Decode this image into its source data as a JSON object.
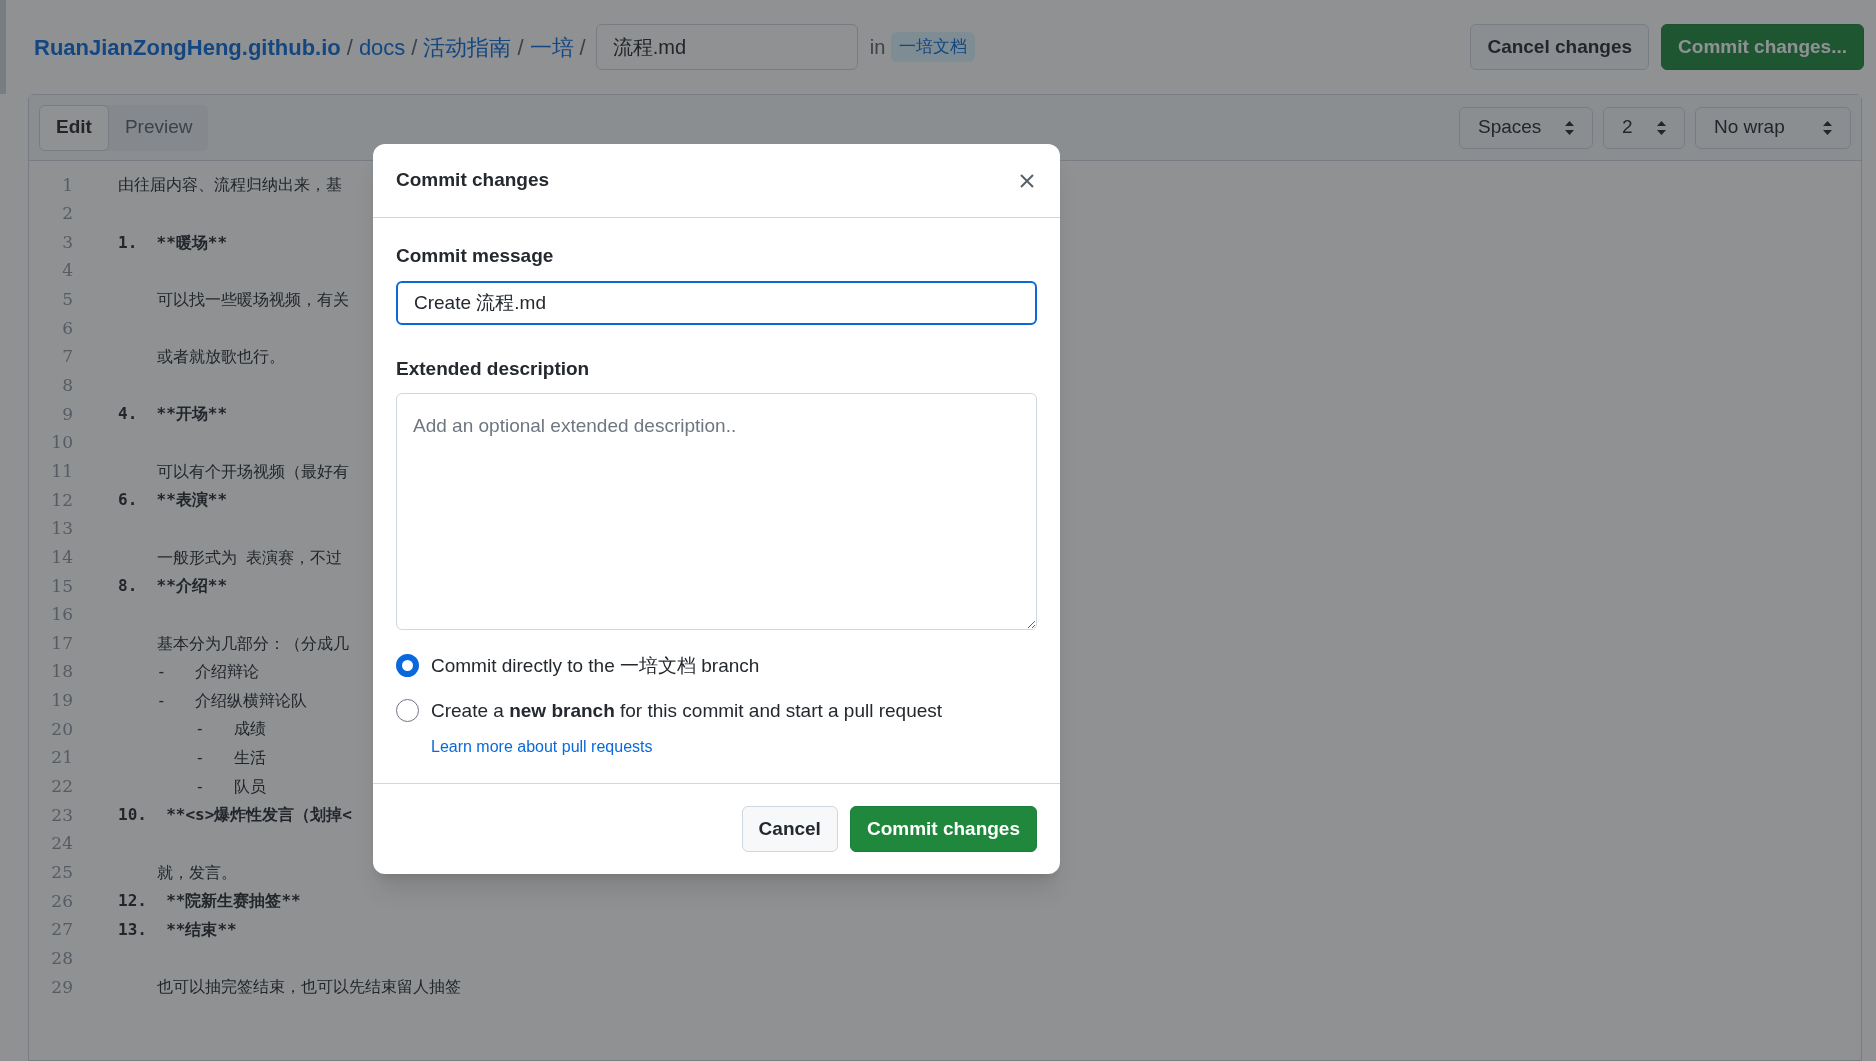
{
  "breadcrumb": {
    "repo": "RuanJianZongHeng.github.io",
    "folders": [
      "docs",
      "活动指南",
      "一培"
    ],
    "separator": "/",
    "filename": "流程.md",
    "in_label": "in",
    "branch": "一培文档"
  },
  "header_buttons": [
    {
      "label": "Cancel changes",
      "kind": "default"
    },
    {
      "label": "Commit changes...",
      "kind": "primary"
    }
  ],
  "tabs": [
    {
      "label": "Edit",
      "selected": true
    },
    {
      "label": "Preview",
      "selected": false
    }
  ],
  "selects": [
    "Spaces",
    "2",
    "No wrap"
  ],
  "lines": [
    {
      "number": "1",
      "kind": "text",
      "text": "由往届内容、流程归纳出来，基"
    },
    {
      "number": "2",
      "kind": "blank"
    },
    {
      "number": "3",
      "kind": "heading",
      "text": "1.  **暖场**"
    },
    {
      "number": "4",
      "kind": "blank"
    },
    {
      "number": "5",
      "kind": "text",
      "text": "    可以找一些暖场视频，有关"
    },
    {
      "number": "6",
      "kind": "blank"
    },
    {
      "number": "7",
      "kind": "text",
      "text": "    或者就放歌也行。"
    },
    {
      "number": "8",
      "kind": "blank"
    },
    {
      "number": "9",
      "kind": "heading",
      "text": "4.  **开场**"
    },
    {
      "number": "10",
      "kind": "blank"
    },
    {
      "number": "11",
      "kind": "text",
      "text": "    可以有个开场视频（最好有"
    },
    {
      "number": "12",
      "kind": "heading",
      "text": "6.  **表演**"
    },
    {
      "number": "13",
      "kind": "blank"
    },
    {
      "number": "14",
      "kind": "text",
      "text": "    一般形式为 表演赛，不过"
    },
    {
      "number": "15",
      "kind": "heading",
      "text": "8.  **介绍**"
    },
    {
      "number": "16",
      "kind": "blank"
    },
    {
      "number": "17",
      "kind": "text",
      "text": "    基本分为几部分：（分成几"
    },
    {
      "number": "18",
      "kind": "text",
      "text": "    -   介绍辩论"
    },
    {
      "number": "19",
      "kind": "text",
      "text": "    -   介绍纵横辩论队"
    },
    {
      "number": "20",
      "kind": "text",
      "text": "        -   成绩"
    },
    {
      "number": "21",
      "kind": "text",
      "text": "        -   生活"
    },
    {
      "number": "22",
      "kind": "text",
      "text": "        -   队员"
    },
    {
      "number": "23",
      "kind": "heading",
      "text": "10.  **<s>爆炸性发言（划掉<"
    },
    {
      "number": "24",
      "kind": "blank"
    },
    {
      "number": "25",
      "kind": "text",
      "text": "    就，发言。"
    },
    {
      "number": "26",
      "kind": "heading",
      "text": "12.  **院新生赛抽签**"
    },
    {
      "number": "27",
      "kind": "heading",
      "text": "13.  **结束**"
    },
    {
      "number": "28",
      "kind": "blank"
    },
    {
      "number": "29",
      "kind": "text",
      "text": "    也可以抽完签结束，也可以先结束留人抽签"
    }
  ],
  "dialog": {
    "title": "Commit changes",
    "message_label": "Commit message",
    "message_value": "Create 流程.md",
    "description_label": "Extended description",
    "description_placeholder": "Add an optional extended description..",
    "options": [
      {
        "label": "Commit directly to the 一培文档 branch",
        "selected": true
      },
      {
        "label": "Create a **new branch** for this commit and start a pull request",
        "selected": false,
        "link": "Learn more about pull requests"
      }
    ],
    "buttons": [
      {
        "label": "Cancel",
        "kind": "default"
      },
      {
        "label": "Commit changes",
        "kind": "primary"
      }
    ]
  }
}
